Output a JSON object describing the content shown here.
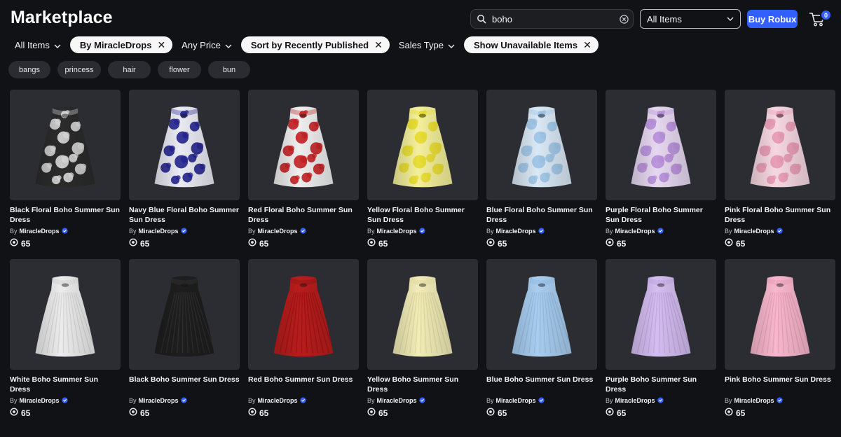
{
  "header": {
    "title": "Marketplace",
    "search_value": "boho",
    "category_value": "All Items",
    "buy_robux_label": "Buy Robux",
    "cart_count": "0"
  },
  "filters": [
    {
      "label": "All Items",
      "kind": "dropdown"
    },
    {
      "label": "By MiracleDrops",
      "kind": "pill"
    },
    {
      "label": "Any Price",
      "kind": "dropdown"
    },
    {
      "label": "Sort by Recently Published",
      "kind": "pill"
    },
    {
      "label": "Sales Type",
      "kind": "dropdown"
    },
    {
      "label": "Show Unavailable Items",
      "kind": "pill"
    }
  ],
  "tags": [
    "bangs",
    "princess",
    "hair",
    "flower",
    "bun"
  ],
  "creator_prefix": "By",
  "items": [
    {
      "name": "Black Floral Boho Summer Sun Dress",
      "creator": "MiracleDrops",
      "price": "65",
      "color": "#2b2b2b",
      "accent": "#d9d9d9",
      "pattern": "floral"
    },
    {
      "name": "Navy Blue Floral Boho Summer Sun Dress",
      "creator": "MiracleDrops",
      "price": "65",
      "color": "#e9eaf2",
      "accent": "#23238f",
      "pattern": "floral"
    },
    {
      "name": "Red Floral Boho Summer Sun Dress",
      "creator": "MiracleDrops",
      "price": "65",
      "color": "#eeeeee",
      "accent": "#c41f22",
      "pattern": "floral"
    },
    {
      "name": "Yellow Floral Boho Summer Sun Dress",
      "creator": "MiracleDrops",
      "price": "65",
      "color": "#f3ef9a",
      "accent": "#e8dc2e",
      "pattern": "floral"
    },
    {
      "name": "Blue Floral Boho Summer Sun Dress",
      "creator": "MiracleDrops",
      "price": "65",
      "color": "#d9e8f5",
      "accent": "#9cc4e6",
      "pattern": "floral"
    },
    {
      "name": "Purple Floral Boho Summer Sun Dress",
      "creator": "MiracleDrops",
      "price": "65",
      "color": "#e6d7f0",
      "accent": "#b78fd9",
      "pattern": "floral"
    },
    {
      "name": "Pink Floral Boho Summer Sun Dress",
      "creator": "MiracleDrops",
      "price": "65",
      "color": "#f6d7e1",
      "accent": "#e79ab4",
      "pattern": "floral"
    },
    {
      "name": "White Boho Summer Sun Dress",
      "creator": "MiracleDrops",
      "price": "65",
      "color": "#ececec",
      "accent": "#c9c9c9",
      "pattern": "plain"
    },
    {
      "name": "Black Boho Summer Sun Dress",
      "creator": "MiracleDrops",
      "price": "65",
      "color": "#1e1e1e",
      "accent": "#3a3a3a",
      "pattern": "plain"
    },
    {
      "name": "Red Boho Summer Sun Dress",
      "creator": "MiracleDrops",
      "price": "65",
      "color": "#b81c1c",
      "accent": "#8a1111",
      "pattern": "plain"
    },
    {
      "name": "Yellow Boho Summer Sun Dress",
      "creator": "MiracleDrops",
      "price": "65",
      "color": "#f1ecb8",
      "accent": "#d6cf8f",
      "pattern": "plain"
    },
    {
      "name": "Blue Boho Summer Sun Dress",
      "creator": "MiracleDrops",
      "price": "65",
      "color": "#a9cdef",
      "accent": "#86b2db",
      "pattern": "plain"
    },
    {
      "name": "Purple Boho Summer Sun Dress",
      "creator": "MiracleDrops",
      "price": "65",
      "color": "#d4bdf0",
      "accent": "#b59bd8",
      "pattern": "plain"
    },
    {
      "name": "Pink Boho Summer Sun Dress",
      "creator": "MiracleDrops",
      "price": "65",
      "color": "#f7b7cc",
      "accent": "#e393ae",
      "pattern": "plain"
    }
  ],
  "colors": {
    "background": "#111216",
    "primary": "#335fff",
    "verified": "#335fff",
    "pill_bg": "#f7f7f8",
    "tag_bg": "#2a2c31"
  }
}
